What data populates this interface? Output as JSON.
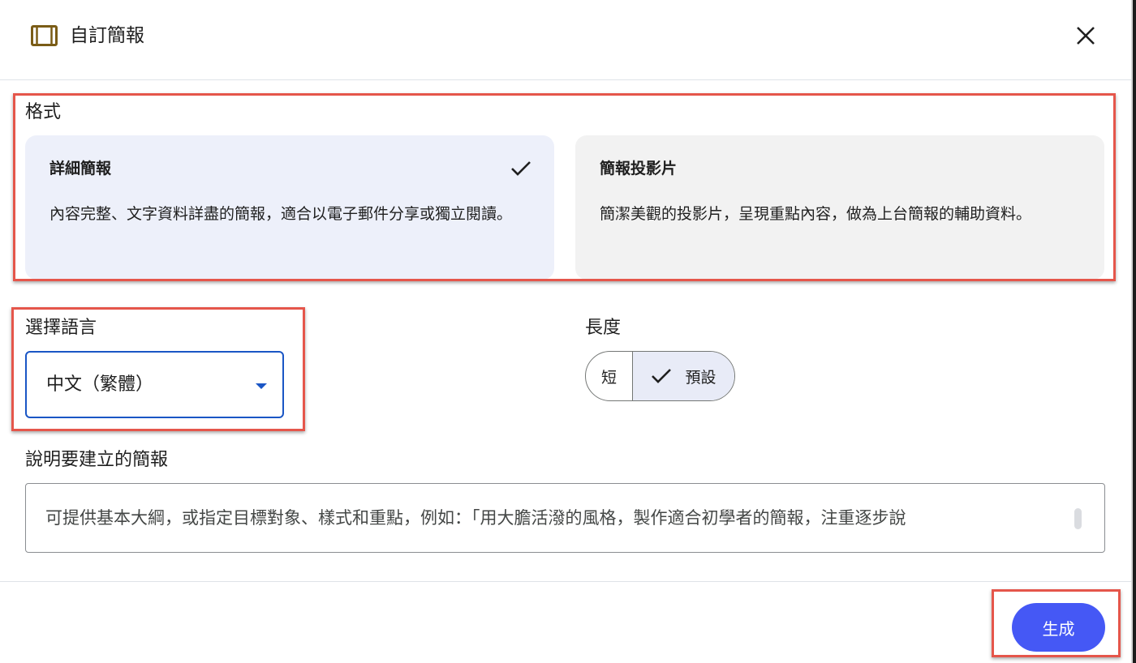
{
  "dialog": {
    "title": "自訂簡報",
    "icon": "slides-icon",
    "close_icon": "close-icon"
  },
  "format": {
    "label": "格式",
    "options": [
      {
        "title": "詳細簡報",
        "description": "內容完整、文字資料詳盡的簡報，適合以電子郵件分享或獨立閱讀。",
        "selected": true
      },
      {
        "title": "簡報投影片",
        "description": "簡潔美觀的投影片，呈現重點內容，做為上台簡報的輔助資料。",
        "selected": false
      }
    ]
  },
  "language": {
    "label": "選擇語言",
    "selected": "中文（繁體）"
  },
  "length": {
    "label": "長度",
    "options": [
      {
        "label": "短",
        "selected": false
      },
      {
        "label": "預設",
        "selected": true
      }
    ]
  },
  "description": {
    "label": "說明要建立的簡報",
    "placeholder": "可提供基本大綱，或指定目標對象、樣式和重點，例如：「用大膽活潑的風格，製作適合初學者的簡報，注重逐步說"
  },
  "actions": {
    "generate_label": "生成"
  },
  "colors": {
    "accent": "#4558f5",
    "select_border": "#1a56c5",
    "selected_card": "#edf0fa",
    "highlight": "#e5564b"
  }
}
